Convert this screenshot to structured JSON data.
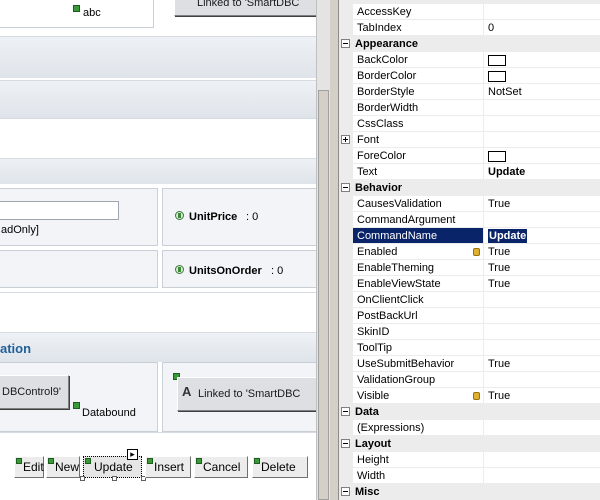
{
  "designer": {
    "top_cell_text": "abc",
    "top_right_button": "Linked to 'SmartDBC",
    "input_suffix": "adOnly]",
    "unit_price_label": "UnitPrice",
    "unit_price_value": ": 0",
    "units_on_order_label": "UnitsOnOrder",
    "units_on_order_value": ": 0",
    "section_title": "ation",
    "control_button": "DBControl9'",
    "databound_label": "Databound",
    "linked_button": "Linked to 'SmartDBC",
    "toolbar": {
      "edit": "Edit",
      "new": "New",
      "update": "Update",
      "insert": "Insert",
      "cancel": "Cancel",
      "delete": "Delete"
    },
    "smart_tag": "▸"
  },
  "property_grid": {
    "rows": [
      {
        "type": "prop",
        "name": "AccessKey",
        "value": ""
      },
      {
        "type": "prop",
        "name": "TabIndex",
        "value": "0"
      },
      {
        "type": "cat",
        "name": "Appearance"
      },
      {
        "type": "prop",
        "name": "BackColor",
        "value": "",
        "swatch": "#ffffff"
      },
      {
        "type": "prop",
        "name": "BorderColor",
        "value": "",
        "swatch": "#ffffff"
      },
      {
        "type": "prop",
        "name": "BorderStyle",
        "value": "NotSet"
      },
      {
        "type": "prop",
        "name": "BorderWidth",
        "value": ""
      },
      {
        "type": "prop",
        "name": "CssClass",
        "value": ""
      },
      {
        "type": "expand",
        "name": "Font",
        "value": ""
      },
      {
        "type": "prop",
        "name": "ForeColor",
        "value": "",
        "swatch": "#ffffff"
      },
      {
        "type": "prop",
        "name": "Text",
        "value": "Update",
        "bold": true
      },
      {
        "type": "cat",
        "name": "Behavior"
      },
      {
        "type": "prop",
        "name": "CausesValidation",
        "value": "True"
      },
      {
        "type": "prop",
        "name": "CommandArgument",
        "value": ""
      },
      {
        "type": "prop",
        "name": "CommandName",
        "value": "Update",
        "selected": true
      },
      {
        "type": "prop",
        "name": "Enabled",
        "value": "True",
        "lock": true
      },
      {
        "type": "prop",
        "name": "EnableTheming",
        "value": "True"
      },
      {
        "type": "prop",
        "name": "EnableViewState",
        "value": "True"
      },
      {
        "type": "prop",
        "name": "OnClientClick",
        "value": ""
      },
      {
        "type": "prop",
        "name": "PostBackUrl",
        "value": ""
      },
      {
        "type": "prop",
        "name": "SkinID",
        "value": ""
      },
      {
        "type": "prop",
        "name": "ToolTip",
        "value": ""
      },
      {
        "type": "prop",
        "name": "UseSubmitBehavior",
        "value": "True"
      },
      {
        "type": "prop",
        "name": "ValidationGroup",
        "value": ""
      },
      {
        "type": "prop",
        "name": "Visible",
        "value": "True",
        "lock": true
      },
      {
        "type": "cat",
        "name": "Data"
      },
      {
        "type": "prop",
        "name": "(Expressions)",
        "value": ""
      },
      {
        "type": "cat",
        "name": "Layout"
      },
      {
        "type": "prop",
        "name": "Height",
        "value": ""
      },
      {
        "type": "prop",
        "name": "Width",
        "value": ""
      },
      {
        "type": "cat",
        "name": "Misc"
      }
    ]
  },
  "colors": {
    "selection": "#0a246a",
    "category_bg": "#ececec",
    "section_title": "#1f5f9a"
  }
}
